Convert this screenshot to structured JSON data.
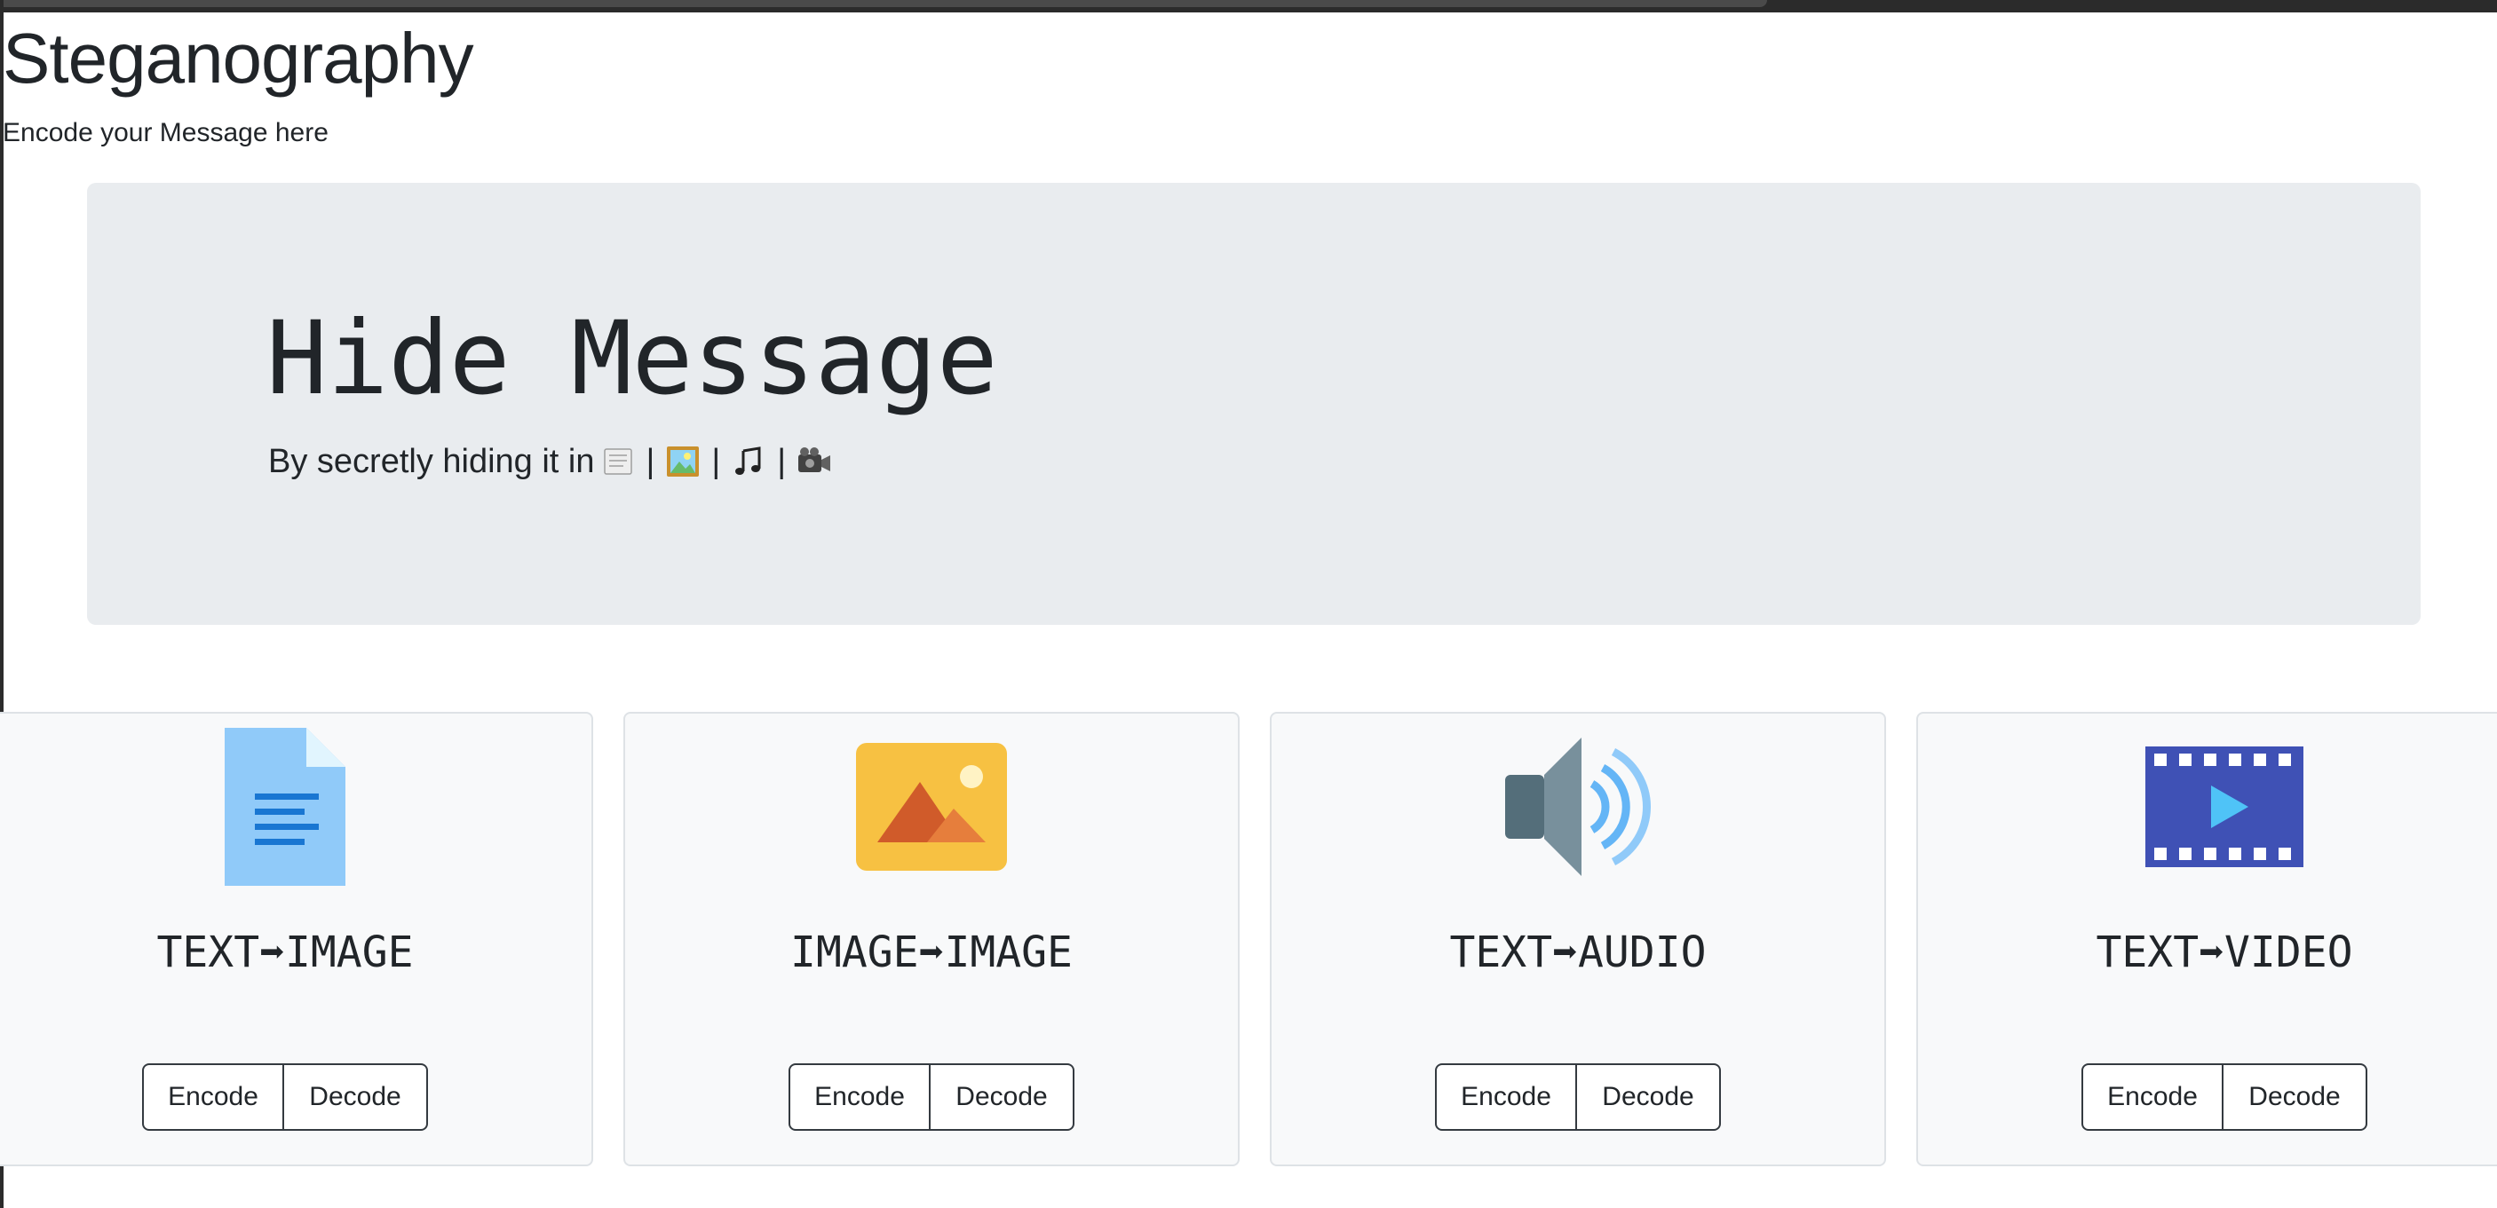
{
  "header": {
    "title": "Steganography",
    "subtitle": "Encode your Message here"
  },
  "hero": {
    "title": "Hide Message",
    "lead_text": "By secretly hiding it in",
    "separator": "|",
    "media_icons": [
      "scroll-icon",
      "framed-picture-icon",
      "music-note-icon",
      "video-camera-icon"
    ]
  },
  "cards": [
    {
      "title": "TEXT➡IMAGE",
      "icon": "document-icon",
      "encode_label": "Encode",
      "decode_label": "Decode"
    },
    {
      "title": "IMAGE➡IMAGE",
      "icon": "image-icon",
      "encode_label": "Encode",
      "decode_label": "Decode"
    },
    {
      "title": "TEXT➡AUDIO",
      "icon": "speaker-icon",
      "encode_label": "Encode",
      "decode_label": "Decode"
    },
    {
      "title": "TEXT➡VIDEO",
      "icon": "film-icon",
      "encode_label": "Encode",
      "decode_label": "Decode"
    }
  ],
  "colors": {
    "jumbotron_bg": "#e9ecef",
    "card_bg": "#f8f9fa",
    "button_border": "#343a40",
    "document_blue": "#90caf9",
    "image_yellow": "#f7c142",
    "speaker_gray": "#607d8b",
    "film_indigo": "#3f51b5"
  }
}
